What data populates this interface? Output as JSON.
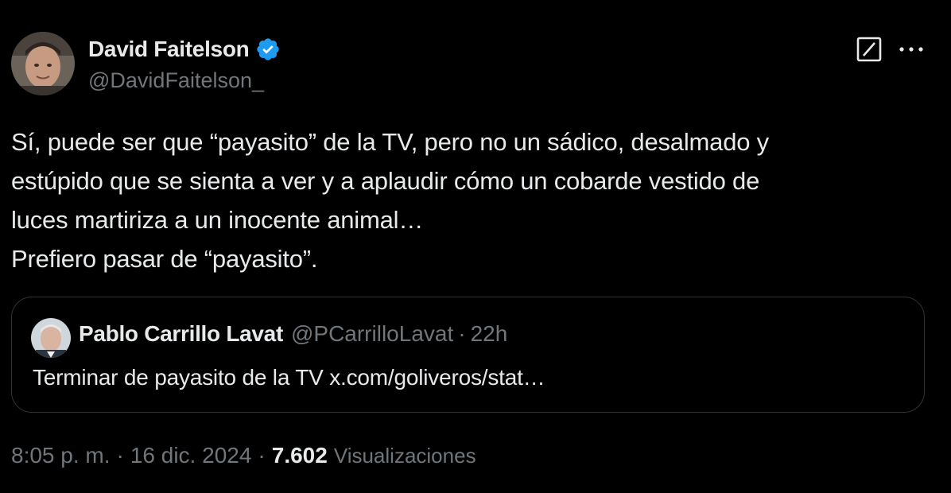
{
  "author": {
    "display_name": "David Faitelson",
    "handle": "@DavidFaitelson_",
    "verified": true
  },
  "icons": {
    "verified": "verified-badge-icon",
    "grok": "grok-icon",
    "more": "more-options-icon"
  },
  "colors": {
    "verified_blue": "#1d9bf0",
    "text_primary": "#e7e9ea",
    "text_secondary": "#71767b",
    "border": "#2f3336",
    "background": "#000000"
  },
  "tweet": {
    "text": "Sí, puede ser que “payasito” de la TV, pero no un sádico, desalmado y\nestúpido que se sienta a ver y a aplaudir cómo un cobarde vestido de\nluces martiriza a un inocente animal…\nPrefiero pasar de “payasito”."
  },
  "quoted_tweet": {
    "display_name": "Pablo Carrillo Lavat",
    "handle": "@PCarrilloLavat",
    "separator": "·",
    "time": "22h",
    "text": "Terminar de payasito de la TV x.com/goliveros/stat…"
  },
  "meta": {
    "time": "8:05 p. m.",
    "separator": "·",
    "date": "16 dic. 2024",
    "views_count": "7.602",
    "views_label": "Visualizaciones"
  }
}
